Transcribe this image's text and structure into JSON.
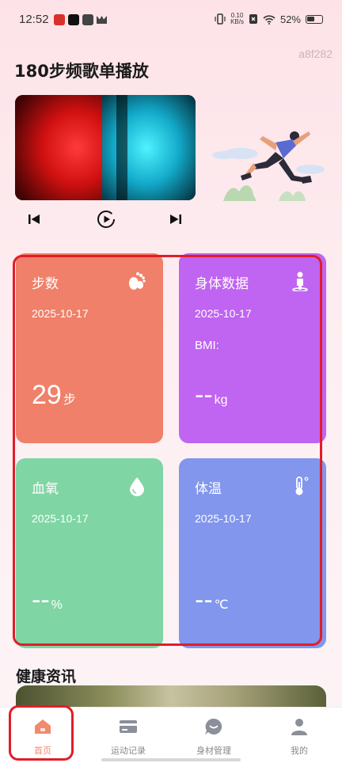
{
  "status_bar": {
    "time": "12:52",
    "net_speed_value": "0.10",
    "net_speed_unit": "KB/s",
    "battery": "52%"
  },
  "watermark": "a8f282",
  "page_title": "180步频歌单播放",
  "player": {
    "prev_icon": "skip-previous-icon",
    "play_icon": "play-icon",
    "next_icon": "skip-next-icon"
  },
  "cards": {
    "steps": {
      "title": "步数",
      "date": "2025-10-17",
      "value": "29",
      "unit": "步",
      "icon": "footprint-icon",
      "color": "#f08069"
    },
    "body": {
      "title": "身体数据",
      "date": "2025-10-17",
      "bmi_label": "BMI:",
      "value": "--",
      "unit": "kg",
      "icon": "person-icon",
      "color": "#c064f2"
    },
    "oxygen": {
      "title": "血氧",
      "date": "2025-10-17",
      "value": "--",
      "unit": "%",
      "icon": "droplet-icon",
      "color": "#7fd5a4"
    },
    "temp": {
      "title": "体温",
      "date": "2025-10-17",
      "value": "--",
      "unit": "℃",
      "icon": "thermometer-icon",
      "color": "#8196ec"
    }
  },
  "health_news": {
    "title": "健康资讯"
  },
  "tabs": [
    {
      "label": "首页",
      "icon": "home-icon",
      "active": true
    },
    {
      "label": "运动记录",
      "icon": "card-icon",
      "active": false
    },
    {
      "label": "身材管理",
      "icon": "chat-icon",
      "active": false
    },
    {
      "label": "我的",
      "icon": "user-icon",
      "active": false
    }
  ],
  "colors": {
    "accent": "#f28a6d",
    "highlight": "#e11d28"
  }
}
